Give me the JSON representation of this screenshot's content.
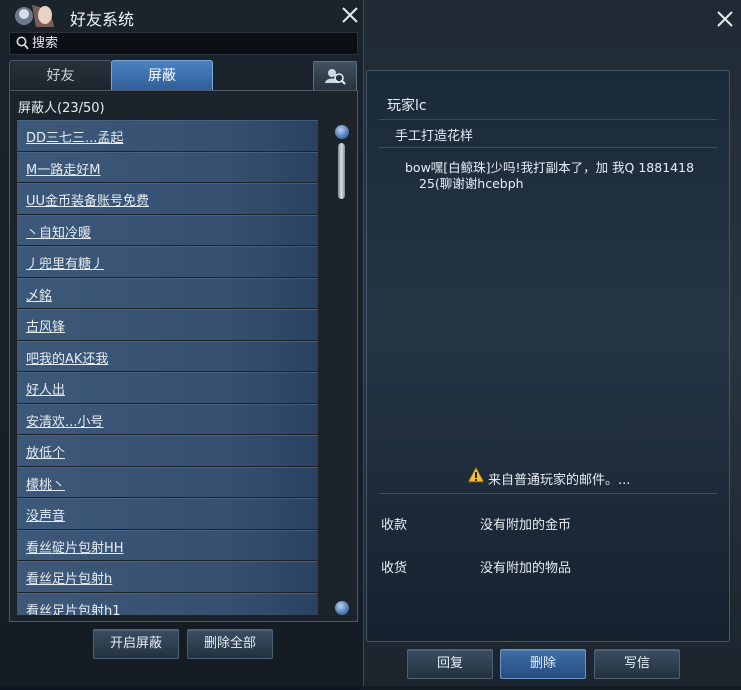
{
  "friend_window": {
    "title": "好友系统",
    "search": {
      "placeholder": "搜索",
      "value": ""
    },
    "tabs": [
      {
        "label": "好友",
        "active": false
      },
      {
        "label": "屏蔽",
        "active": true
      }
    ],
    "list_header": "屏蔽人(23/50)",
    "items": [
      "DD三七三...孟起",
      "M一路走好M",
      "UU金币装备账号免费",
      "丶自知冷暖",
      "丿兜里有糖丿",
      "乄銘",
      "古风锋",
      "吧我的AK还我",
      "好人出",
      "安清欢...小号",
      "放低个",
      "檬桃丶",
      "没声音",
      "看丝碇片包射HH",
      "看丝足片包射h",
      "看丝足片包射h1"
    ],
    "buttons": {
      "enable_block": "开启屏蔽",
      "delete_all": "删除全部"
    },
    "icons": {
      "search": "search-icon",
      "close": "close-icon",
      "user_search": "user-search-icon"
    }
  },
  "mail": {
    "sender": "玩家lc",
    "subject": "手工打造花样",
    "body_line1": "bow嘿[白鲸珠]少吗!我打副本了，加 我Q 1881418",
    "body_line2": "25(聊谢谢hcebph",
    "notice": "来自普通玩家的邮件。...",
    "rows": [
      {
        "label": "收款",
        "value": "没有附加的金币"
      },
      {
        "label": "收货",
        "value": "没有附加的物品"
      }
    ],
    "buttons": {
      "reply": "回复",
      "delete": "删除",
      "write": "写信"
    }
  },
  "colors": {
    "accent_blue": "#3f6ea8",
    "list_item": "#3d5878",
    "panel_border": "#46566a",
    "warning_yellow": "#f2c12e"
  }
}
